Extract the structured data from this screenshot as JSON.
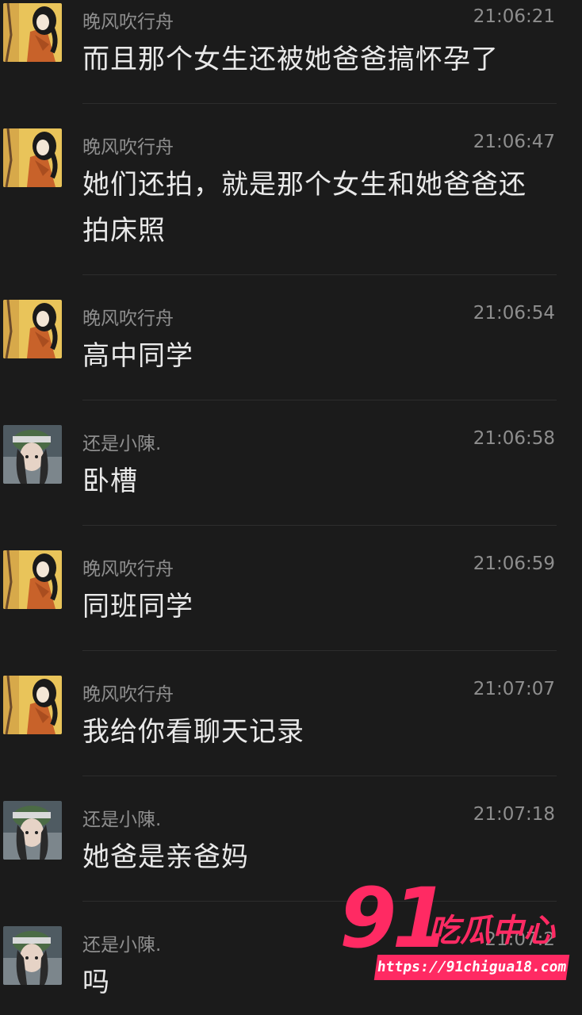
{
  "messages": [
    {
      "sender": "晚风吹行舟",
      "time": "21:06:21",
      "text": "而且那个女生还被她爸爸搞怀孕了",
      "avatar": "cartoon-avatar"
    },
    {
      "sender": "晚风吹行舟",
      "time": "21:06:47",
      "text": "她们还拍，就是那个女生和她爸爸还拍床照",
      "avatar": "cartoon-avatar"
    },
    {
      "sender": "晚风吹行舟",
      "time": "21:06:54",
      "text": "高中同学",
      "avatar": "cartoon-avatar"
    },
    {
      "sender": "还是小陳.",
      "time": "21:06:58",
      "text": "卧槽",
      "avatar": "photo-avatar"
    },
    {
      "sender": "晚风吹行舟",
      "time": "21:06:59",
      "text": "同班同学",
      "avatar": "cartoon-avatar"
    },
    {
      "sender": "晚风吹行舟",
      "time": "21:07:07",
      "text": "我给你看聊天记录",
      "avatar": "cartoon-avatar"
    },
    {
      "sender": "还是小陳.",
      "time": "21:07:18",
      "text": "她爸是亲爸妈",
      "avatar": "photo-avatar"
    },
    {
      "sender": "还是小陳.",
      "time": "21:07:2",
      "text": "吗",
      "avatar": "photo-avatar"
    }
  ],
  "watermark": {
    "number": "91",
    "brand": "吃瓜中心",
    "url": "https://91chigua18.com",
    "color": "#ff2a63"
  },
  "colors": {
    "background": "#1b1b1b",
    "meta_text": "#8e8e8e",
    "message_text": "#e9e9e9"
  }
}
